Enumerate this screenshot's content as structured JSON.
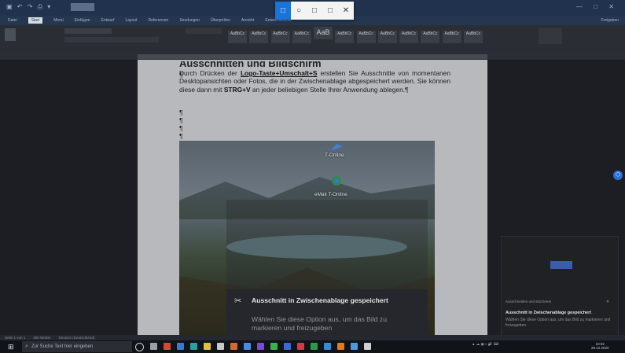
{
  "ribbon": {
    "tabs": [
      "Datei",
      "Start",
      "Menü",
      "Einfügen",
      "Entwurf",
      "Layout",
      "Referenzen",
      "Sendungen",
      "Überprüfen",
      "Ansicht",
      "Entwicklertools"
    ],
    "active_tab": "Start",
    "share_label": "Freigeben",
    "styles": [
      "AaBbCc",
      "AaBbCc",
      "AaBbCc",
      "AaBbCc",
      "AaB",
      "AaBbCc",
      "AaBbCc",
      "AaBbCc",
      "AaBbCc",
      "AaBbCc",
      "AaBbCc",
      "AaBbCc"
    ]
  },
  "snip_toolbar": {
    "buttons": [
      "□",
      "○",
      "□",
      "□",
      "✕"
    ]
  },
  "document": {
    "heading": "Ausschnitten und Bildschirm",
    "paragraph": {
      "pre": "Durch Drücken der ",
      "shortcut1": "Logo-Taste+Umschalt+S",
      "mid": " erstellen Sie Ausschnitte von momentanen Desktopansichten oder Fotos, die in der Zwischenablage abgespeichert werden. Sie können diese dann mit ",
      "shortcut2": "STRG+V",
      "post": " an jeder beliebigen Stelle Ihrer Anwendung ablegen.¶"
    },
    "pilcrow": "¶"
  },
  "desktop_icons": [
    {
      "label": "T-Online",
      "icon": "t-online-icon"
    },
    {
      "label": "eMail T-Online",
      "icon": "email-t-online-icon"
    }
  ],
  "toast": {
    "title": "Ausschnitt in Zwischenablage gespeichert",
    "body": "Wählen Sie diese Option aus, um das Bild zu markieren und freizugeben"
  },
  "notification": {
    "header": "Ausschneiden und skizzieren",
    "title": "Ausschnitt in Zwischenablage gespeichert",
    "body": "Wählen Sie diese Option aus, um das Bild zu markieren und freizugeben"
  },
  "statusbar": {
    "page": "Seite 1 von 1",
    "words": "480 Wörter",
    "language": "Deutsch (Deutschland)"
  },
  "taskbar": {
    "search_placeholder": "Zur Suche Text hier eingeben",
    "time": "10:02",
    "date": "28.12.2020"
  },
  "colors": {
    "accent": "#1a73d9",
    "titlebar": "#20324d"
  }
}
